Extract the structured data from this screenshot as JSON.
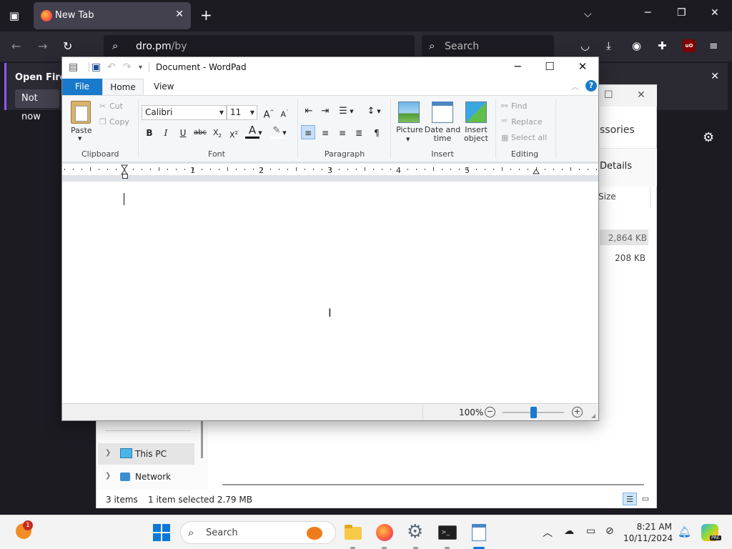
{
  "firefox": {
    "tab_title": "New Tab",
    "url_host": "dro.pm",
    "url_path": "/by",
    "search_placeholder": "Search",
    "notification_text": "Open Firefo",
    "notification_button": "Not now",
    "icons": [
      "tab-list-icon",
      "firefox-logo-icon",
      "close-icon",
      "plus-icon",
      "chevron-down-icon",
      "back-arrow-icon",
      "forward-arrow-icon",
      "reload-icon",
      "search-icon",
      "pocket-icon",
      "download-icon",
      "account-icon",
      "extensions-icon",
      "ublock-icon",
      "hamburger-menu-icon",
      "gear-icon"
    ]
  },
  "explorer": {
    "header_fragment": "ssories",
    "details_label": "Details",
    "size_header": "Size",
    "sizes": [
      "2,864 KB",
      "208 KB"
    ],
    "nav_items": [
      {
        "label": "This PC",
        "selected": true
      },
      {
        "label": "Network",
        "selected": false
      }
    ],
    "status_items": "3 items",
    "status_selected": "1 item selected  2.79 MB"
  },
  "wordpad": {
    "title": "Document - WordPad",
    "tabs": {
      "file": "File",
      "home": "Home",
      "view": "View"
    },
    "clipboard": {
      "paste": "Paste",
      "cut": "Cut",
      "copy": "Copy",
      "group": "Clipboard"
    },
    "font": {
      "family": "Calibri",
      "size": "11",
      "group": "Font",
      "grow": "A",
      "shrink": "A"
    },
    "paragraph": {
      "group": "Paragraph"
    },
    "insert": {
      "picture": "Picture",
      "datetime_1": "Date and",
      "datetime_2": "time",
      "object_1": "Insert",
      "object_2": "object",
      "group": "Insert"
    },
    "editing": {
      "find": "Find",
      "replace": "Replace",
      "select_all": "Select all",
      "group": "Editing"
    },
    "ruler_numbers": [
      "1",
      "2",
      "3",
      "4",
      "5"
    ],
    "zoom": {
      "level": "100%",
      "slider_fraction": 0.5
    },
    "colors": {
      "file_tab": "#1979ca",
      "accent": "#0a78d7"
    }
  },
  "taskbar": {
    "weather_badge": "1",
    "search_placeholder": "Search",
    "time": "8:21 AM",
    "date": "10/11/2024",
    "copilot_badge": "PRE",
    "pinned": [
      "file-explorer-icon",
      "firefox-icon",
      "settings-icon",
      "terminal-icon",
      "wordpad-icon"
    ],
    "tray_icons": [
      "chevron-up-icon",
      "cloud-off-icon",
      "display-icon",
      "network-off-icon",
      "bell-icon"
    ]
  }
}
